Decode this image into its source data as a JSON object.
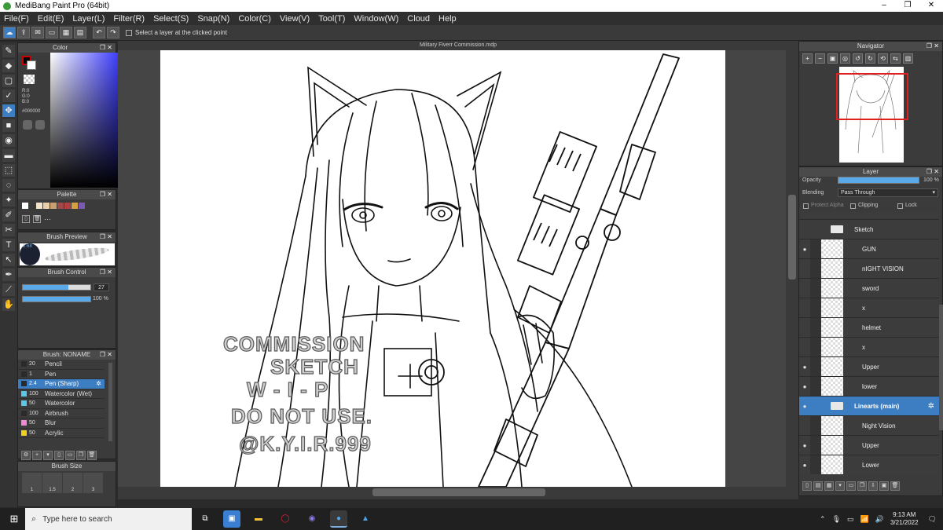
{
  "window": {
    "title": "MediBang Paint Pro (64bit)",
    "controls": [
      "–",
      "❐",
      "✕"
    ]
  },
  "menu": [
    "File(F)",
    "Edit(E)",
    "Layer(L)",
    "Filter(R)",
    "Select(S)",
    "Snap(N)",
    "Color(C)",
    "View(V)",
    "Tool(T)",
    "Window(W)",
    "Cloud",
    "Help"
  ],
  "toolbar": {
    "checkbox_label": "Select a layer at the clicked point"
  },
  "panels": {
    "color": {
      "title": "Color",
      "rgb": [
        "R:0",
        "G:0",
        "B:0"
      ],
      "hex": "#000000",
      "fg_color": "#000000",
      "bg_color": "#ffffff"
    },
    "palette": {
      "title": "Palette",
      "swatches": [
        "#ffffff",
        "#3a3a3a",
        "#f4e3c8",
        "#e8cfa8",
        "#c8a070",
        "#9e4a4a",
        "#b24040",
        "#d4a040",
        "#7a5ab0"
      ],
      "more": "···"
    },
    "brush_preview": {
      "title": "Brush Preview",
      "size_label": "2.68"
    },
    "brush_control": {
      "title": "Brush Control",
      "size_value": "27",
      "size_fraction": 0.68,
      "opacity_value": "100 %",
      "opacity_fraction": 1.0
    },
    "brush_list": {
      "title": "Brush: NONAME",
      "items": [
        {
          "num": "20",
          "name": "Pencil",
          "color": "#2a2a2a"
        },
        {
          "num": "1",
          "name": "Pen",
          "color": "#2a2a2a"
        },
        {
          "num": "2.4",
          "name": "Pen (Sharp)",
          "color": "#2a2a2a",
          "selected": true
        },
        {
          "num": "100",
          "name": "Watercolor (Wet)",
          "color": "#5ac8e8"
        },
        {
          "num": "50",
          "name": "Watercolor",
          "color": "#5ac8e8"
        },
        {
          "num": "100",
          "name": "Airbrush",
          "color": "#2a2a2a"
        },
        {
          "num": "50",
          "name": "Blur",
          "color": "#f08ad8"
        },
        {
          "num": "50",
          "name": "Acrylic",
          "color": "#f0d020"
        }
      ]
    },
    "brush_size": {
      "title": "Brush Size",
      "cells": [
        "1",
        "1.5",
        "2",
        "3"
      ]
    },
    "navigator": {
      "title": "Navigator"
    },
    "layer": {
      "title": "Layer",
      "opacity_label": "Opacity",
      "opacity_value": "100 %",
      "blending_label": "Blending",
      "blending_value": "Pass Through",
      "protect_alpha": "Protect Alpha",
      "clipping": "Clipping",
      "lock": "Lock",
      "layers": [
        {
          "name": "Sketch",
          "type": "folder",
          "visible": false,
          "selected": false
        },
        {
          "name": "GUN",
          "type": "layer",
          "visible": true,
          "selected": false
        },
        {
          "name": "nIGHT VISION",
          "type": "layer",
          "visible": false,
          "selected": false
        },
        {
          "name": "sword",
          "type": "layer",
          "visible": false,
          "selected": false
        },
        {
          "name": "x",
          "type": "layer",
          "visible": false,
          "selected": false
        },
        {
          "name": "helmet",
          "type": "layer",
          "visible": false,
          "selected": false
        },
        {
          "name": "x",
          "type": "layer",
          "visible": false,
          "selected": false
        },
        {
          "name": "Upper",
          "type": "layer",
          "visible": true,
          "selected": false
        },
        {
          "name": "lower",
          "type": "layer",
          "visible": true,
          "selected": false
        },
        {
          "name": "Linearts (main)",
          "type": "folder",
          "visible": true,
          "selected": true
        },
        {
          "name": "Night Vision",
          "type": "layer",
          "visible": false,
          "selected": false
        },
        {
          "name": "Upper",
          "type": "layer",
          "visible": true,
          "selected": false
        },
        {
          "name": "Lower",
          "type": "layer",
          "visible": true,
          "selected": false
        }
      ]
    }
  },
  "document": {
    "title": "Military Fiverr Commission.mdp",
    "watermark": [
      "COMMISSION",
      "SKETCH",
      "W - I - P",
      "DO NOT USE.",
      "@K.Y.I.R.999"
    ]
  },
  "taskbar": {
    "search_placeholder": "Type here to search",
    "time": "9:13 AM",
    "date": "3/21/2022"
  }
}
